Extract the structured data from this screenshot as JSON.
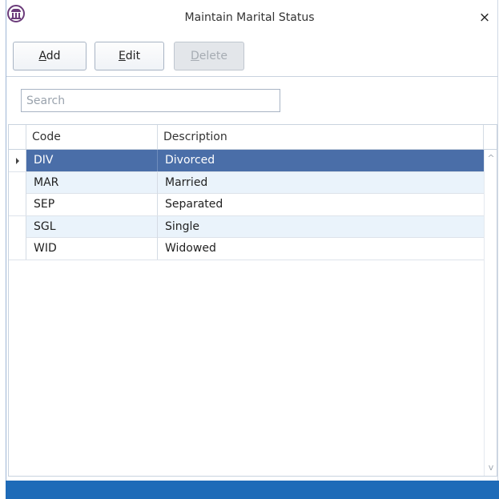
{
  "window": {
    "title": "Maintain Marital Status",
    "close_glyph": "×",
    "icon": "building-columns-icon"
  },
  "toolbar": {
    "add": {
      "mnemonic": "A",
      "rest": "dd"
    },
    "edit": {
      "mnemonic": "E",
      "rest": "dit"
    },
    "delete": {
      "mnemonic": "D",
      "rest": "elete",
      "disabled": true
    }
  },
  "search": {
    "placeholder": "Search",
    "value": ""
  },
  "grid": {
    "columns": [
      "Code",
      "Description"
    ],
    "rows": [
      {
        "code": "DIV",
        "description": "Divorced",
        "selected": true
      },
      {
        "code": "MAR",
        "description": "Married"
      },
      {
        "code": "SEP",
        "description": "Separated"
      },
      {
        "code": "SGL",
        "description": "Single"
      },
      {
        "code": "WID",
        "description": "Widowed"
      }
    ],
    "scroll_up_glyph": "^",
    "scroll_down_glyph": "v"
  },
  "colors": {
    "selected_row": "#4a6ea8",
    "alt_row": "#eaf3fb",
    "status_bar": "#1e6bb8",
    "icon_accent": "#6b3b7a"
  }
}
